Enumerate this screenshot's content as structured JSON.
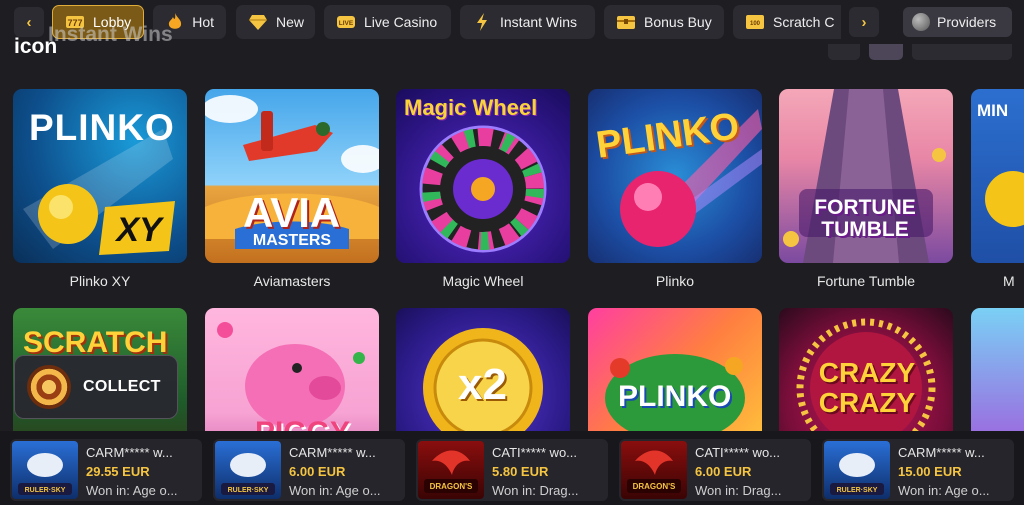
{
  "nav": {
    "prev_arrow": "‹",
    "next_arrow": "›",
    "tabs": [
      {
        "label": "Lobby",
        "icon": "slot-777-icon",
        "active": true
      },
      {
        "label": "Hot",
        "icon": "flame-icon",
        "active": false
      },
      {
        "label": "New",
        "icon": "diamond-icon",
        "active": false
      },
      {
        "label": "Live Casino",
        "icon": "live-badge-icon",
        "active": false
      },
      {
        "label": "Instant Wins",
        "icon": "lightning-icon",
        "active": false
      },
      {
        "label": "Bonus Buy",
        "icon": "treasure-chest-icon",
        "active": false
      },
      {
        "label": "Scratch C",
        "icon": "scratch-card-icon",
        "active": false
      }
    ],
    "providers_label": "Providers",
    "accent": "#e0ac3a"
  },
  "section": {
    "title": "icon",
    "ghost_title": "Instant Wins"
  },
  "games": [
    {
      "name": "Plinko XY",
      "art": "PLINKO"
    },
    {
      "name": "Aviamasters",
      "art": "AVIA"
    },
    {
      "name": "Magic Wheel",
      "art": "Magic Wheel"
    },
    {
      "name": "Plinko",
      "art": "PLINKO"
    },
    {
      "name": "Fortune Tumble",
      "art": "FORTUNE TUMBLE"
    },
    {
      "name": "M",
      "art": "MIN"
    }
  ],
  "games_row2": [
    {
      "art": "SCRATCH"
    },
    {
      "art": "PIGGY"
    },
    {
      "art": "x2"
    },
    {
      "art": "PLINKO"
    },
    {
      "art": "CRAZY CRAZY"
    },
    {
      "art": ""
    }
  ],
  "collect_label": "COLLECT",
  "winners": [
    {
      "user": "CARM***** w...",
      "amount": "29.55 EUR",
      "game": "Won in: Age o..."
    },
    {
      "user": "CARM***** w...",
      "amount": "6.00 EUR",
      "game": "Won in: Age o..."
    },
    {
      "user": "CATI***** wo...",
      "amount": "5.80 EUR",
      "game": "Won in: Drag..."
    },
    {
      "user": "CATI***** wo...",
      "amount": "6.00 EUR",
      "game": "Won in: Drag..."
    },
    {
      "user": "CARM***** w...",
      "amount": "15.00 EUR",
      "game": "Won in: Age o..."
    }
  ]
}
